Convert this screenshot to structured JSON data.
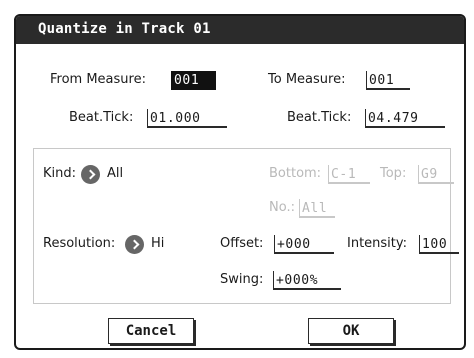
{
  "dialog": {
    "title": "Quantize in Track 01",
    "from_measure": {
      "label": "From Measure:",
      "value": "001"
    },
    "to_measure": {
      "label": "To Measure:",
      "value": "001"
    },
    "from_beat_tick": {
      "label": "Beat.Tick:",
      "value": "01.000"
    },
    "to_beat_tick": {
      "label": "Beat.Tick:",
      "value": "04.479"
    },
    "kind": {
      "label": "Kind:",
      "value": "All"
    },
    "bottom": {
      "label": "Bottom:",
      "value": "C-1"
    },
    "top": {
      "label": "Top:",
      "value": "G9"
    },
    "no": {
      "label": "No.:",
      "value": "All"
    },
    "resolution": {
      "label": "Resolution:",
      "value": "Hi"
    },
    "offset": {
      "label": "Offset:",
      "value": "+000"
    },
    "intensity": {
      "label": "Intensity:",
      "value": "100"
    },
    "swing": {
      "label": "Swing:",
      "value": "+000%"
    },
    "buttons": {
      "cancel": "Cancel",
      "ok": "OK"
    }
  }
}
